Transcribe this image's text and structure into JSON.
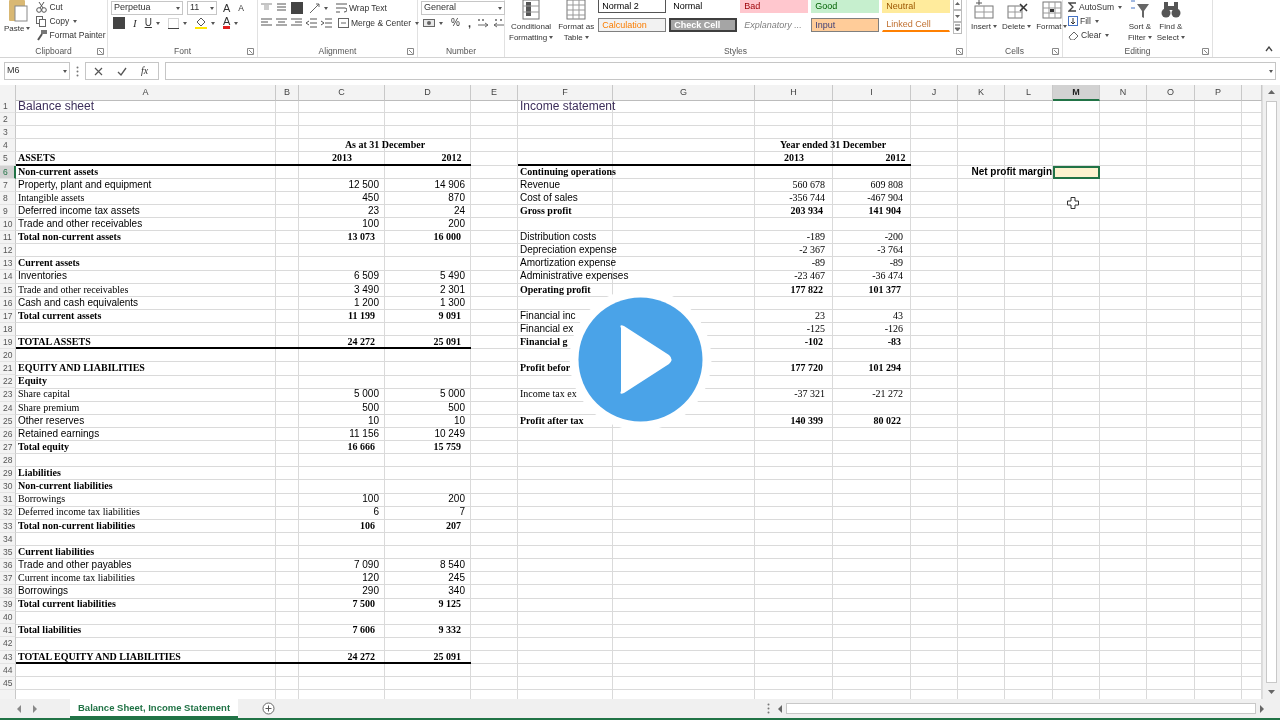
{
  "ribbon": {
    "clipboard": {
      "label": "Clipboard",
      "paste": "Paste",
      "cut": "Cut",
      "copy": "Copy",
      "format_painter": "Format Painter"
    },
    "font": {
      "label": "Font",
      "font_name": "Perpetua",
      "font_size": "11",
      "grow": "A",
      "shrink": "A",
      "italic": "I",
      "underline": "U",
      "font_color": "A"
    },
    "alignment": {
      "label": "Alignment",
      "wrap_text": "Wrap Text",
      "merge_center": "Merge & Center"
    },
    "number": {
      "label": "Number",
      "format": "General",
      "percent": "%",
      "comma": ","
    },
    "styles": {
      "label": "Styles",
      "conditional": [
        "Conditional",
        "Formatting"
      ],
      "format_table": [
        "Format as",
        "Table"
      ],
      "gallery": [
        {
          "label": "Normal 2",
          "kind": "normal",
          "selected": true
        },
        {
          "label": "Normal",
          "kind": "normal",
          "selected": false
        },
        {
          "label": "Bad",
          "kind": "bad",
          "selected": false
        },
        {
          "label": "Good",
          "kind": "good",
          "selected": false
        },
        {
          "label": "Neutral",
          "kind": "neutral",
          "selected": false
        },
        {
          "label": "Calculation",
          "kind": "calculation",
          "selected": false
        },
        {
          "label": "Check Cell",
          "kind": "check",
          "selected": false
        },
        {
          "label": "Explanatory ...",
          "kind": "explanatory",
          "selected": false
        },
        {
          "label": "Input",
          "kind": "input",
          "selected": false
        },
        {
          "label": "Linked Cell",
          "kind": "linked",
          "selected": false
        }
      ]
    },
    "cells": {
      "label": "Cells",
      "buttons": [
        "Insert",
        "Delete",
        "Format"
      ]
    },
    "editing": {
      "label": "Editing",
      "autosum": "AutoSum",
      "fill": "Fill",
      "clear": "Clear",
      "sort_filter": [
        "Sort &",
        "Filter"
      ],
      "find_select": [
        "Find &",
        "Select"
      ]
    }
  },
  "formula_bar": {
    "name_box": "M6",
    "function_label": "fx"
  },
  "columns": [
    {
      "label": "A",
      "selected": false
    },
    {
      "label": "B",
      "selected": false
    },
    {
      "label": "C",
      "selected": false
    },
    {
      "label": "D",
      "selected": false
    },
    {
      "label": "E",
      "selected": false
    },
    {
      "label": "F",
      "selected": false
    },
    {
      "label": "G",
      "selected": false
    },
    {
      "label": "H",
      "selected": false
    },
    {
      "label": "I",
      "selected": false
    },
    {
      "label": "J",
      "selected": false
    },
    {
      "label": "K",
      "selected": false
    },
    {
      "label": "L",
      "selected": false
    },
    {
      "label": "M",
      "selected": true
    },
    {
      "label": "N",
      "selected": false
    },
    {
      "label": "O",
      "selected": false
    },
    {
      "label": "P",
      "selected": false
    }
  ],
  "rows": [
    {
      "number": "1",
      "selected": false,
      "A": {
        "text": "Balance sheet",
        "kind": "title"
      },
      "F": {
        "text": "Income statement",
        "kind": "title"
      }
    },
    {
      "number": "2",
      "selected": false
    },
    {
      "number": "3",
      "selected": false
    },
    {
      "number": "4",
      "selected": false,
      "C": {
        "text": "As at 31 December",
        "kind": "caption"
      },
      "H": {
        "text": "Year ended 31 December",
        "kind": "caption"
      }
    },
    {
      "number": "5",
      "selected": false,
      "rules": {
        "balance": true,
        "income": true
      },
      "A": {
        "text": "ASSETS",
        "kind": "heading"
      },
      "C": {
        "text": "2013",
        "kind": "year"
      },
      "D": {
        "text": "2012",
        "kind": "year"
      },
      "H": {
        "text": "2013",
        "kind": "year"
      },
      "I": {
        "text": "2012",
        "kind": "year"
      }
    },
    {
      "number": "6",
      "selected": true,
      "A": {
        "text": "Non-current assets",
        "kind": "heading"
      },
      "F": {
        "text": "Continuing operations",
        "kind": "heading"
      },
      "K": {
        "text": "Net profit margin",
        "kind": "label"
      },
      "M": {
        "selected": true,
        "color": "#fdf3cf"
      }
    },
    {
      "number": "7",
      "selected": false,
      "A": {
        "text": "Property, plant and equipment",
        "kind": "text"
      },
      "C": {
        "text": "12 500",
        "kind": "num"
      },
      "D": {
        "text": "14 906",
        "kind": "num"
      },
      "F": {
        "text": "Revenue",
        "kind": "text"
      },
      "H": {
        "text": "560 678",
        "kind": "pnum"
      },
      "I": {
        "text": "609 808",
        "kind": "pnum"
      }
    },
    {
      "number": "8",
      "selected": false,
      "A": {
        "text": "Intangible assets",
        "kind": "print"
      },
      "C": {
        "text": "450",
        "kind": "num"
      },
      "D": {
        "text": "870",
        "kind": "num"
      },
      "F": {
        "text": "Cost of sales",
        "kind": "text"
      },
      "H": {
        "text": "-356 744",
        "kind": "pnum"
      },
      "I": {
        "text": "-467 904",
        "kind": "pnum"
      }
    },
    {
      "number": "9",
      "selected": false,
      "A": {
        "text": "Deferred income tax assets",
        "kind": "text"
      },
      "C": {
        "text": "23",
        "kind": "num"
      },
      "D": {
        "text": "24",
        "kind": "num"
      },
      "F": {
        "text": "Gross profit",
        "kind": "heading"
      },
      "H": {
        "text": "203 934",
        "kind": "total"
      },
      "I": {
        "text": "141 904",
        "kind": "total"
      }
    },
    {
      "number": "10",
      "selected": false,
      "A": {
        "text": "Trade and other receivables",
        "kind": "text"
      },
      "C": {
        "text": "100",
        "kind": "num"
      },
      "D": {
        "text": "200",
        "kind": "num"
      }
    },
    {
      "number": "11",
      "selected": false,
      "A": {
        "text": "Total non-current assets",
        "kind": "heading"
      },
      "C": {
        "text": "13 073",
        "kind": "total"
      },
      "D": {
        "text": "16 000",
        "kind": "total"
      },
      "F": {
        "text": "Distribution costs",
        "kind": "text"
      },
      "H": {
        "text": "-189",
        "kind": "pnum"
      },
      "I": {
        "text": "-200",
        "kind": "pnum"
      }
    },
    {
      "number": "12",
      "selected": false,
      "F": {
        "text": "Depreciation expense",
        "kind": "text"
      },
      "H": {
        "text": "-2 367",
        "kind": "pnum"
      },
      "I": {
        "text": "-3 764",
        "kind": "pnum"
      }
    },
    {
      "number": "13",
      "selected": false,
      "A": {
        "text": "Current assets",
        "kind": "heading"
      },
      "F": {
        "text": "Amortization expense",
        "kind": "text"
      },
      "H": {
        "text": "-89",
        "kind": "pnum"
      },
      "I": {
        "text": "-89",
        "kind": "pnum"
      }
    },
    {
      "number": "14",
      "selected": false,
      "A": {
        "text": "Inventories",
        "kind": "text"
      },
      "C": {
        "text": "6 509",
        "kind": "num"
      },
      "D": {
        "text": "5 490",
        "kind": "num"
      },
      "F": {
        "text": "Administrative expenses",
        "kind": "text"
      },
      "H": {
        "text": "-23 467",
        "kind": "pnum"
      },
      "I": {
        "text": "-36 474",
        "kind": "pnum"
      }
    },
    {
      "number": "15",
      "selected": false,
      "A": {
        "text": "Trade and other receivables",
        "kind": "print"
      },
      "C": {
        "text": "3 490",
        "kind": "num"
      },
      "D": {
        "text": "2 301",
        "kind": "num"
      },
      "F": {
        "text": "Operating profit",
        "kind": "heading"
      },
      "H": {
        "text": "177 822",
        "kind": "total"
      },
      "I": {
        "text": "101 377",
        "kind": "total"
      }
    },
    {
      "number": "16",
      "selected": false,
      "A": {
        "text": "Cash and cash equivalents",
        "kind": "text"
      },
      "C": {
        "text": "1 200",
        "kind": "num"
      },
      "D": {
        "text": "1 300",
        "kind": "num"
      }
    },
    {
      "number": "17",
      "selected": false,
      "A": {
        "text": "Total current assets",
        "kind": "heading"
      },
      "C": {
        "text": "11 199",
        "kind": "total"
      },
      "D": {
        "text": "9 091",
        "kind": "total"
      },
      "F": {
        "text": "Financial inc",
        "kind": "text"
      },
      "H": {
        "text": "23",
        "kind": "pnum"
      },
      "I": {
        "text": "43",
        "kind": "pnum"
      }
    },
    {
      "number": "18",
      "selected": false,
      "F": {
        "text": "Financial ex",
        "kind": "text"
      },
      "H": {
        "text": "-125",
        "kind": "pnum"
      },
      "I": {
        "text": "-126",
        "kind": "pnum"
      }
    },
    {
      "number": "19",
      "selected": false,
      "rules": {
        "balance": true
      },
      "A": {
        "text": "TOTAL ASSETS",
        "kind": "heading"
      },
      "C": {
        "text": "24 272",
        "kind": "total"
      },
      "D": {
        "text": "25 091",
        "kind": "total"
      },
      "F": {
        "text": "Financial g",
        "kind": "heading"
      },
      "H": {
        "text": "-102",
        "kind": "total"
      },
      "I": {
        "text": "-83",
        "kind": "total"
      }
    },
    {
      "number": "20",
      "selected": false
    },
    {
      "number": "21",
      "selected": false,
      "A": {
        "text": "EQUITY AND LIABILITIES",
        "kind": "heading"
      },
      "F": {
        "text": "Profit befor",
        "kind": "heading"
      },
      "H": {
        "text": "177 720",
        "kind": "total"
      },
      "I": {
        "text": "101 294",
        "kind": "total"
      }
    },
    {
      "number": "22",
      "selected": false,
      "A": {
        "text": "Equity",
        "kind": "heading"
      }
    },
    {
      "number": "23",
      "selected": false,
      "A": {
        "text": "Share capital",
        "kind": "print"
      },
      "C": {
        "text": "5 000",
        "kind": "num"
      },
      "D": {
        "text": "5 000",
        "kind": "num"
      },
      "F": {
        "text": "Income tax ex",
        "kind": "print"
      },
      "H": {
        "text": "-37 321",
        "kind": "pnum"
      },
      "I": {
        "text": "-21 272",
        "kind": "pnum"
      }
    },
    {
      "number": "24",
      "selected": false,
      "A": {
        "text": "Share premium",
        "kind": "print"
      },
      "C": {
        "text": "500",
        "kind": "num"
      },
      "D": {
        "text": "500",
        "kind": "num"
      }
    },
    {
      "number": "25",
      "selected": false,
      "A": {
        "text": "Other reserves",
        "kind": "text"
      },
      "C": {
        "text": "10",
        "kind": "num"
      },
      "D": {
        "text": "10",
        "kind": "num"
      },
      "F": {
        "text": "Profit after tax",
        "kind": "heading"
      },
      "H": {
        "text": "140 399",
        "kind": "total"
      },
      "I": {
        "text": "80 022",
        "kind": "total"
      }
    },
    {
      "number": "26",
      "selected": false,
      "A": {
        "text": "Retained earnings",
        "kind": "text"
      },
      "C": {
        "text": "11 156",
        "kind": "num"
      },
      "D": {
        "text": "10 249",
        "kind": "num"
      }
    },
    {
      "number": "27",
      "selected": false,
      "A": {
        "text": "Total equity",
        "kind": "heading"
      },
      "C": {
        "text": "16 666",
        "kind": "total"
      },
      "D": {
        "text": "15 759",
        "kind": "total"
      }
    },
    {
      "number": "28",
      "selected": false
    },
    {
      "number": "29",
      "selected": false,
      "A": {
        "text": "Liabilities",
        "kind": "heading"
      }
    },
    {
      "number": "30",
      "selected": false,
      "A": {
        "text": "Non-current liabilities",
        "kind": "heading"
      }
    },
    {
      "number": "31",
      "selected": false,
      "A": {
        "text": "Borrowings",
        "kind": "print"
      },
      "C": {
        "text": "100",
        "kind": "num"
      },
      "D": {
        "text": "200",
        "kind": "num"
      }
    },
    {
      "number": "32",
      "selected": false,
      "A": {
        "text": "Deferred income tax liabilities",
        "kind": "print"
      },
      "C": {
        "text": "6",
        "kind": "num"
      },
      "D": {
        "text": "7",
        "kind": "num"
      }
    },
    {
      "number": "33",
      "selected": false,
      "A": {
        "text": "Total non-current liabilities",
        "kind": "heading"
      },
      "C": {
        "text": "106",
        "kind": "total"
      },
      "D": {
        "text": "207",
        "kind": "total"
      }
    },
    {
      "number": "34",
      "selected": false
    },
    {
      "number": "35",
      "selected": false,
      "A": {
        "text": "Current liabilities",
        "kind": "heading"
      }
    },
    {
      "number": "36",
      "selected": false,
      "A": {
        "text": "Trade and other payables",
        "kind": "text"
      },
      "C": {
        "text": "7 090",
        "kind": "num"
      },
      "D": {
        "text": "8 540",
        "kind": "num"
      }
    },
    {
      "number": "37",
      "selected": false,
      "A": {
        "text": "Current income tax liabilities",
        "kind": "print"
      },
      "C": {
        "text": "120",
        "kind": "num"
      },
      "D": {
        "text": "245",
        "kind": "num"
      }
    },
    {
      "number": "38",
      "selected": false,
      "A": {
        "text": "Borrowings",
        "kind": "text"
      },
      "C": {
        "text": "290",
        "kind": "num"
      },
      "D": {
        "text": "340",
        "kind": "num"
      }
    },
    {
      "number": "39",
      "selected": false,
      "A": {
        "text": "Total current liabilities",
        "kind": "heading"
      },
      "C": {
        "text": "7 500",
        "kind": "total"
      },
      "D": {
        "text": "9 125",
        "kind": "total"
      }
    },
    {
      "number": "40",
      "selected": false
    },
    {
      "number": "41",
      "selected": false,
      "A": {
        "text": "Total liabilities",
        "kind": "heading"
      },
      "C": {
        "text": "7 606",
        "kind": "total"
      },
      "D": {
        "text": "9 332",
        "kind": "total"
      }
    },
    {
      "number": "42",
      "selected": false
    },
    {
      "number": "43",
      "selected": false,
      "rules": {
        "balance": true
      },
      "A": {
        "text": "TOTAL EQUITY AND LIABILITIES",
        "kind": "heading"
      },
      "C": {
        "text": "24 272",
        "kind": "total"
      },
      "D": {
        "text": "25 091",
        "kind": "total"
      }
    },
    {
      "number": "44",
      "selected": false
    },
    {
      "number": "45",
      "selected": false
    }
  ],
  "sheet_tabs": [
    {
      "label": "Balance Sheet, Income Statement",
      "selected": true
    }
  ]
}
